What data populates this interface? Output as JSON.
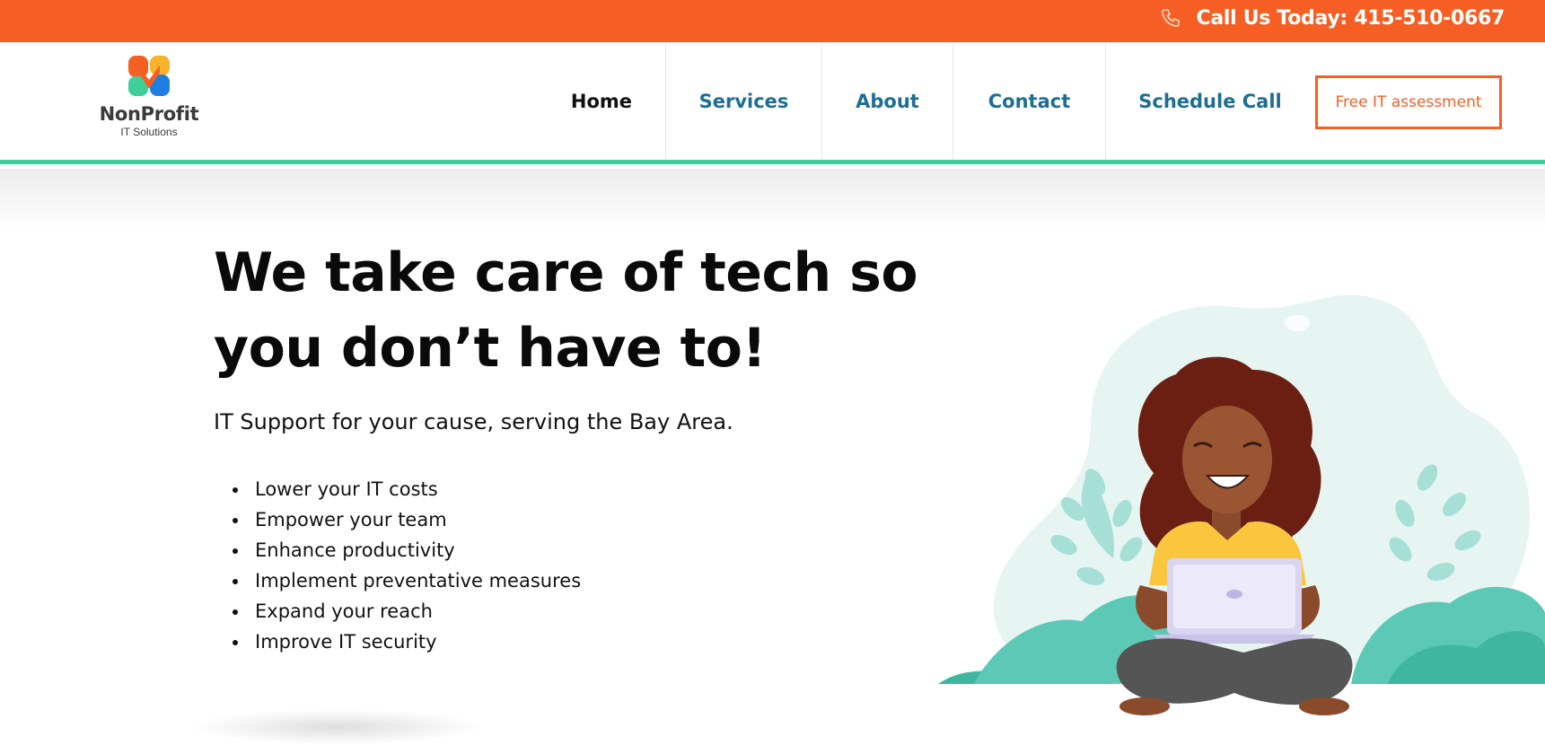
{
  "topbar": {
    "phone_icon": "phone-icon",
    "call_text": "Call Us Today: 415-510-0667"
  },
  "logo": {
    "name": "NonProfit",
    "subtitle": "IT Solutions"
  },
  "nav": {
    "home": "Home",
    "services": "Services",
    "about": "About",
    "contact": "Contact",
    "schedule": "Schedule Call",
    "cta": "Free IT assessment"
  },
  "hero": {
    "headline": "We take care of tech so you don’t have to!",
    "tagline": "IT Support for your cause, serving the Bay Area.",
    "benefits": [
      "Lower your IT costs",
      "Empower your team",
      "Enhance productivity",
      "Implement preventative measures",
      "Expand your reach",
      "Improve IT security"
    ]
  },
  "colors": {
    "brand_orange": "#f55f24",
    "nav_blue": "#1d6e94",
    "accent_green": "#3dd09b",
    "headline": "#0a0a0a"
  }
}
